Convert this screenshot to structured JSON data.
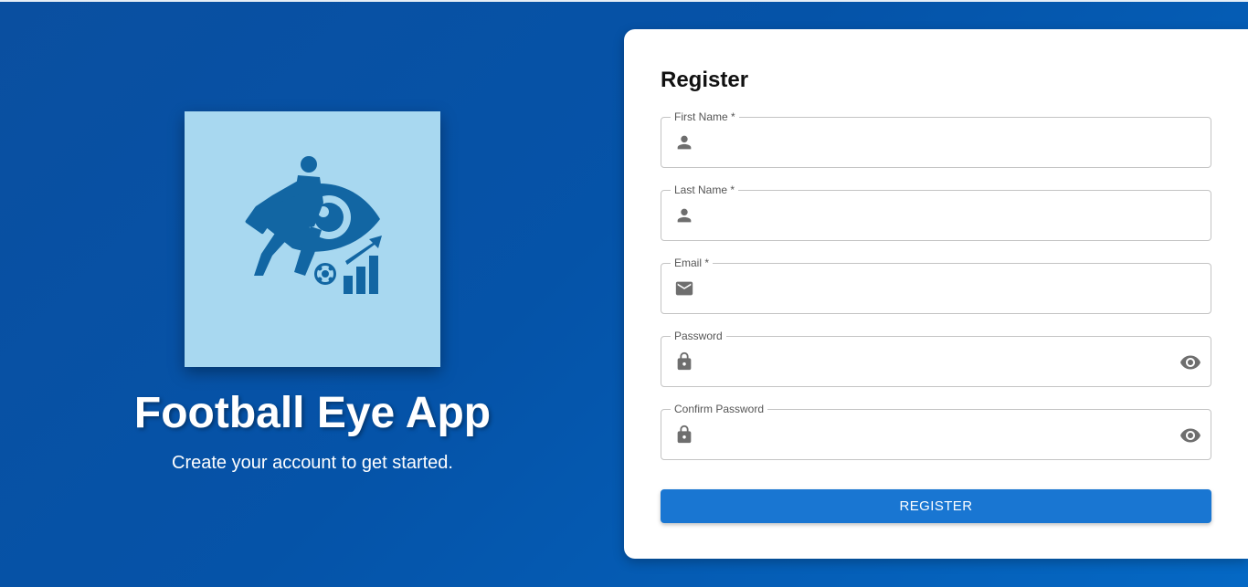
{
  "brand": {
    "title": "Football Eye App",
    "subtitle": "Create your account to get started.",
    "logo_icon": "football-eye-logo"
  },
  "colors": {
    "background": "#0553a8",
    "logo_bg": "#a8d8f0",
    "logo_fg": "#1266a3",
    "button": "#1976d2"
  },
  "form": {
    "title": "Register",
    "fields": [
      {
        "label": "First Name *",
        "icon": "person-icon",
        "value": ""
      },
      {
        "label": "Last Name *",
        "icon": "person-icon",
        "value": ""
      },
      {
        "label": "Email *",
        "icon": "mail-icon",
        "value": ""
      },
      {
        "label": "Password",
        "icon": "lock-icon",
        "value": "",
        "toggle_icon": "eye-icon"
      },
      {
        "label": "Confirm Password",
        "icon": "lock-icon",
        "value": "",
        "toggle_icon": "eye-icon"
      }
    ],
    "submit_label": "REGISTER"
  }
}
